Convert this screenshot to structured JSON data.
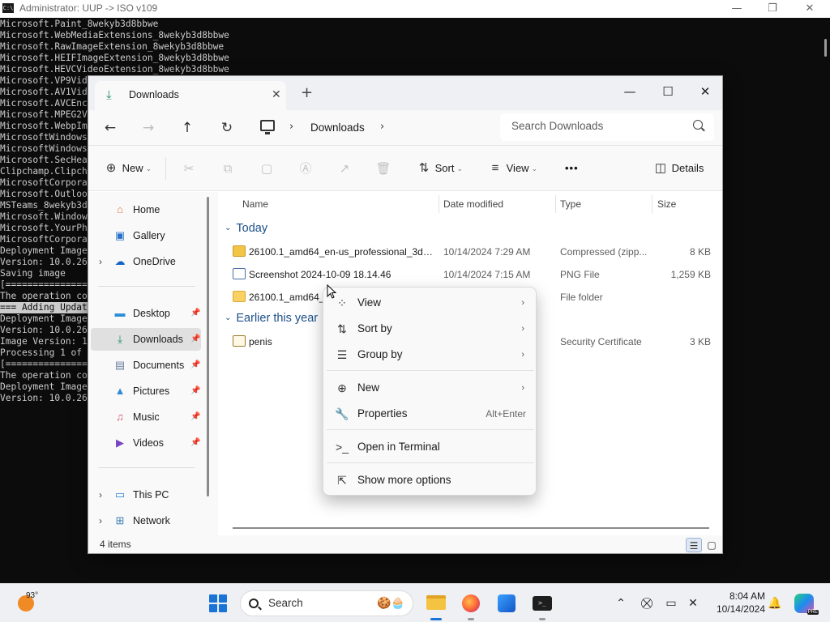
{
  "console": {
    "icon_text": "C:\\",
    "title": "Administrator:  UUP -> ISO v109",
    "lines": [
      "Microsoft.Paint_8wekyb3d8bbwe",
      "Microsoft.WebMediaExtensions_8wekyb3d8bbwe",
      "Microsoft.RawImageExtension_8wekyb3d8bbwe",
      "Microsoft.HEIFImageExtension_8wekyb3d8bbwe",
      "Microsoft.HEVCVideoExtension_8wekyb3d8bbwe",
      "Microsoft.VP9Vid",
      "Microsoft.AV1Vid",
      "Microsoft.AVCEnc",
      "Microsoft.MPEG2V",
      "Microsoft.WebpIm",
      "MicrosoftWindows",
      "MicrosoftWindows",
      "Microsoft.SecHea",
      "Clipchamp.Clipch",
      "MicrosoftCorpora",
      "Microsoft.Outloo",
      "MSTeams_8wekyb3d",
      "Microsoft.Window",
      "Microsoft.YourPh",
      "MicrosoftCorpora",
      "",
      "Deployment Image",
      "Version: 10.0.26",
      "",
      "Saving image",
      "[===============",
      "The operation co",
      "",
      "=== Adding Updat",
      "",
      "Deployment Image",
      "Version: 10.0.26",
      "",
      "Image Version: 1",
      "",
      "Processing 1 of",
      "[===============",
      "The operation co",
      "",
      "Deployment Image",
      "Version: 10.0.26"
    ],
    "highlight_line": 28,
    "caption_buttons": {
      "minimize": "—",
      "maximize": "❐",
      "close": "✕"
    }
  },
  "explorer": {
    "tab": {
      "label": "Downloads",
      "close": "✕",
      "new_tab": "+"
    },
    "caption_buttons": {
      "minimize": "—",
      "maximize": "☐",
      "close": "✕"
    },
    "nav": {
      "back": "←",
      "forward": "→",
      "up": "↑",
      "refresh": "↻"
    },
    "breadcrumb": {
      "separator": "›",
      "current": "Downloads"
    },
    "search": {
      "placeholder": "Search Downloads",
      "value": ""
    },
    "commandbar": {
      "new": "New",
      "sort": "Sort",
      "view": "View",
      "more": "•••",
      "details": "Details"
    },
    "navpane": {
      "items": [
        {
          "label": "Home",
          "icon": "home-icon",
          "glyph": "⌂",
          "color": "#e07b39"
        },
        {
          "label": "Gallery",
          "icon": "gallery-icon",
          "glyph": "▣",
          "color": "#2a73c9"
        },
        {
          "label": "OneDrive",
          "icon": "onedrive-icon",
          "glyph": "☁",
          "color": "#1565c0",
          "expandable": "›"
        },
        {
          "label": "Desktop",
          "icon": "desktop-icon",
          "glyph": "▬",
          "color": "#2c8fd6",
          "pinned": true
        },
        {
          "label": "Downloads",
          "icon": "downloads-icon",
          "glyph": "⤓",
          "color": "#1f8f5f",
          "pinned": true,
          "selected": true
        },
        {
          "label": "Documents",
          "icon": "documents-icon",
          "glyph": "▤",
          "color": "#6b7fa0",
          "pinned": true
        },
        {
          "label": "Pictures",
          "icon": "pictures-icon",
          "glyph": "▲",
          "color": "#2f89d8",
          "pinned": true
        },
        {
          "label": "Music",
          "icon": "music-icon",
          "glyph": "♫",
          "color": "#d4566d",
          "pinned": true
        },
        {
          "label": "Videos",
          "icon": "videos-icon",
          "glyph": "▶",
          "color": "#7a45c4",
          "pinned": true
        },
        {
          "label": "This PC",
          "icon": "this-pc-icon",
          "glyph": "▭",
          "color": "#2a7ec8",
          "expandable": "›"
        },
        {
          "label": "Network",
          "icon": "network-icon",
          "glyph": "⊞",
          "color": "#3c7fb6",
          "expandable": "›"
        }
      ],
      "pin_glyph": "📌"
    },
    "columns": {
      "name": "Name",
      "date": "Date modified",
      "type": "Type",
      "size": "Size"
    },
    "groups": [
      {
        "label": "Today",
        "files": [
          {
            "name": "26100.1_amd64_en-us_professional_3d68...",
            "date": "10/14/2024 7:29 AM",
            "type": "Compressed (zipp...",
            "size": "8 KB",
            "icon": "zip"
          },
          {
            "name": "Screenshot 2024-10-09 18.14.46",
            "date": "10/14/2024 7:15 AM",
            "type": "PNG File",
            "size": "1,259 KB",
            "icon": "png"
          },
          {
            "name": "26100.1_amd64_e",
            "date": "",
            "type": "File folder",
            "size": "",
            "icon": "folder"
          }
        ]
      },
      {
        "label": "Earlier this year",
        "files": [
          {
            "name": "penis",
            "date": "",
            "type": "Security Certificate",
            "size": "3 KB",
            "icon": "cert"
          }
        ]
      }
    ],
    "status": {
      "count": "4 items"
    }
  },
  "context_menu": {
    "items": [
      {
        "label": "View",
        "icon": "view-grid-icon",
        "glyph": "⁘",
        "submenu": "›"
      },
      {
        "label": "Sort by",
        "icon": "sort-icon",
        "glyph": "⇅",
        "submenu": "›"
      },
      {
        "label": "Group by",
        "icon": "group-by-icon",
        "glyph": "☰",
        "submenu": "›"
      },
      {
        "label": "New",
        "icon": "new-icon",
        "glyph": "⊕",
        "submenu": "›"
      },
      {
        "label": "Properties",
        "icon": "properties-icon",
        "glyph": "🔧",
        "accelerator": "Alt+Enter"
      },
      {
        "label": "Open in Terminal",
        "icon": "terminal-icon",
        "glyph": ">_"
      },
      {
        "label": "Show more options",
        "icon": "more-options-icon",
        "glyph": "⇱"
      }
    ]
  },
  "taskbar": {
    "weather_temp": "93°",
    "search_label": "Search",
    "search_deco": "🍪🧁",
    "time": "8:04 AM",
    "date": "10/14/2024",
    "copilot_badge": "PRE",
    "tray": {
      "chevron": "⌃",
      "network": "⛒",
      "display": "▭",
      "volume": "✕",
      "bell": "🔔"
    }
  }
}
